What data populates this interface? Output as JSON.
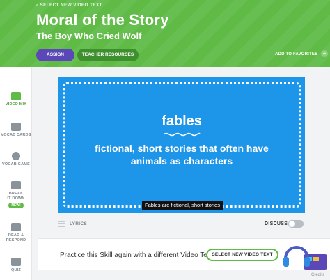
{
  "header": {
    "select_link": "SELECT NEW VIDEO TEXT",
    "title": "Moral of the Story",
    "subtitle": "The Boy Who Cried Wolf",
    "assign_label": "ASSIGN",
    "teacher_label": "TEACHER RESOURCES",
    "favorites_label": "ADD TO FAVORITES",
    "favorites_icon": "+"
  },
  "sidebar": {
    "items": [
      {
        "label": "VIDEO MIX",
        "icon": "video-icon",
        "active": true
      },
      {
        "label": "VOCAB CARDS",
        "icon": "cards-icon"
      },
      {
        "label": "VOCAB GAME",
        "icon": "game-icon"
      },
      {
        "label": "BREAK IT DOWN",
        "icon": "puzzle-icon",
        "badge": "NEW!"
      },
      {
        "label": "READ & RESPOND",
        "icon": "book-icon"
      },
      {
        "label": "QUIZ",
        "icon": "quiz-icon"
      }
    ]
  },
  "video": {
    "heading": "fables",
    "definition": "fictional, short stories that often have animals as characters",
    "caption": "Fables are fictional, short stories"
  },
  "controls": {
    "lyrics_label": "LYRICS",
    "discuss_label": "DISCUSS"
  },
  "practice": {
    "text": "Practice this Skill again with a different Video Text",
    "button_label": "SELECT NEW VIDEO TEXT"
  },
  "footer": {
    "credits": "Credits"
  },
  "colors": {
    "header_green": "#5fbb46",
    "assign_purple": "#5b47b7",
    "video_blue": "#1d95e8"
  }
}
